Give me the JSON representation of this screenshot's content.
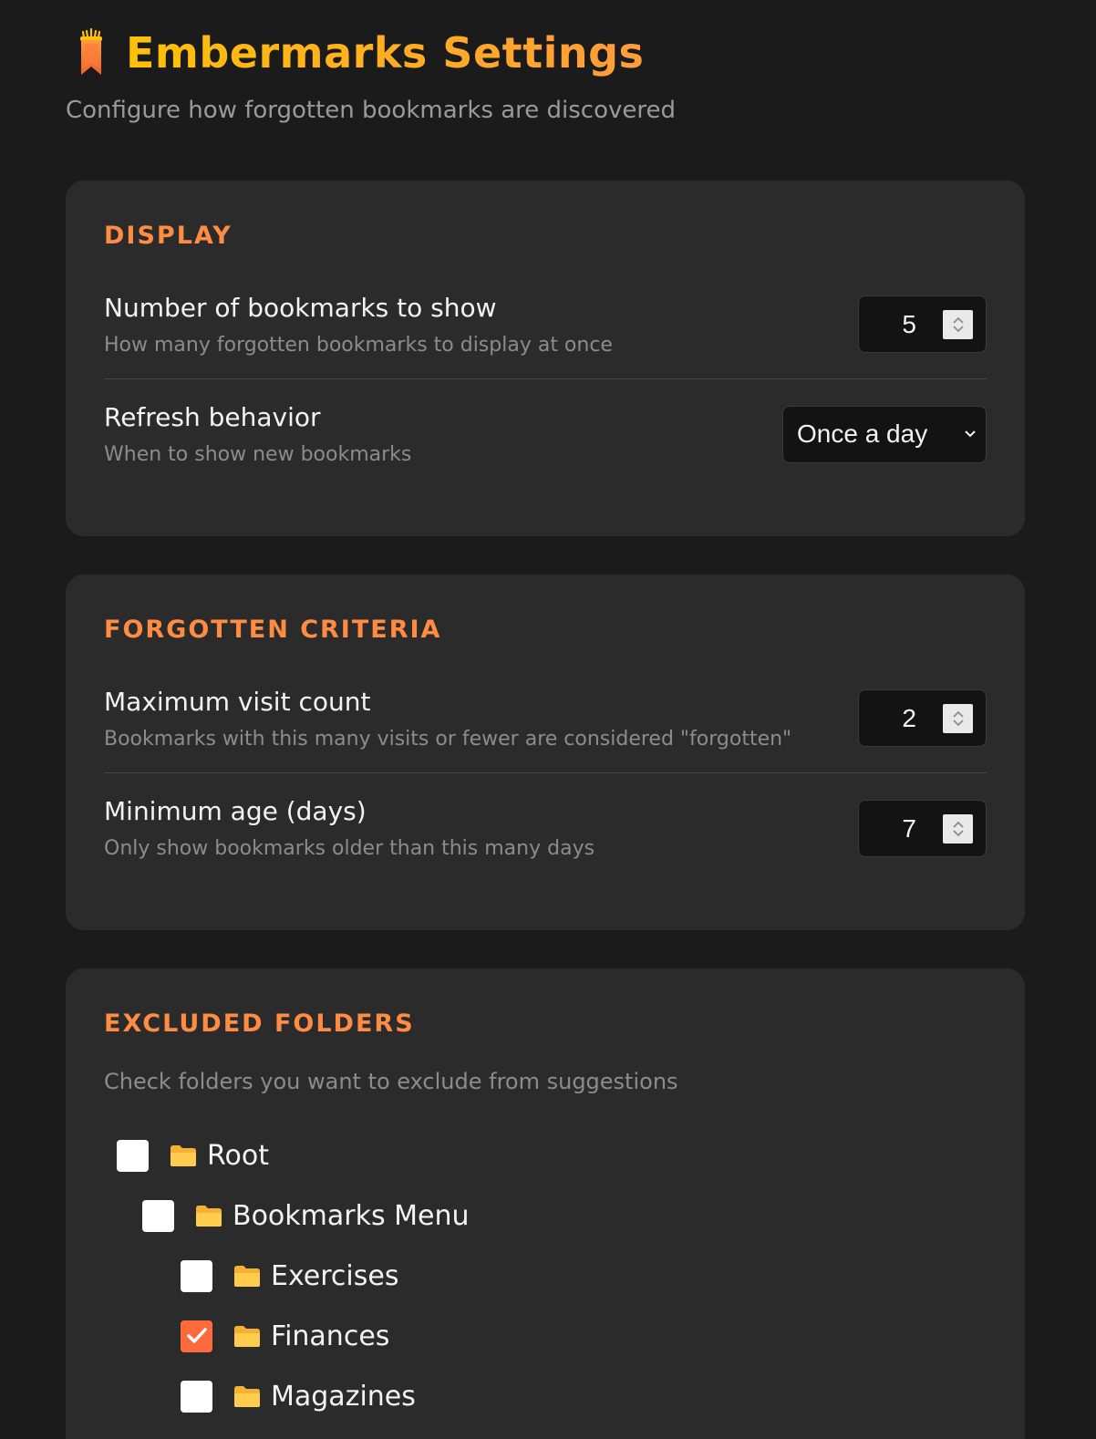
{
  "header": {
    "logo_icon": "bookmark-flame-icon",
    "title": "Embermarks Settings",
    "subtitle": "Configure how forgotten bookmarks are discovered"
  },
  "colors": {
    "accent": "#ff8c42",
    "title_gradient_start": "#ffc107",
    "title_gradient_end": "#ff9b3d",
    "checkbox_checked": "#ff6a3d",
    "background": "#1b1b1c",
    "card": "#2b2b2c"
  },
  "display": {
    "section_title": "DISPLAY",
    "bookmark_count": {
      "label": "Number of bookmarks to show",
      "description": "How many forgotten bookmarks to display at once",
      "value": "5"
    },
    "refresh": {
      "label": "Refresh behavior",
      "description": "When to show new bookmarks",
      "selected": "Once a day"
    }
  },
  "criteria": {
    "section_title": "FORGOTTEN CRITERIA",
    "max_visits": {
      "label": "Maximum visit count",
      "description": "Bookmarks with this many visits or fewer are considered \"forgotten\"",
      "value": "2"
    },
    "min_age": {
      "label": "Minimum age (days)",
      "description": "Only show bookmarks older than this many days",
      "value": "7"
    }
  },
  "folders": {
    "section_title": "EXCLUDED FOLDERS",
    "description": "Check folders you want to exclude from suggestions",
    "items": [
      {
        "name": "Root",
        "checked": false,
        "depth": 0,
        "icon": "folder-icon"
      },
      {
        "name": "Bookmarks Menu",
        "checked": false,
        "depth": 1,
        "icon": "folder-icon"
      },
      {
        "name": "Exercises",
        "checked": false,
        "depth": 2,
        "icon": "folder-icon"
      },
      {
        "name": "Finances",
        "checked": true,
        "depth": 2,
        "icon": "folder-icon"
      },
      {
        "name": "Magazines",
        "checked": false,
        "depth": 2,
        "icon": "folder-icon"
      }
    ]
  }
}
